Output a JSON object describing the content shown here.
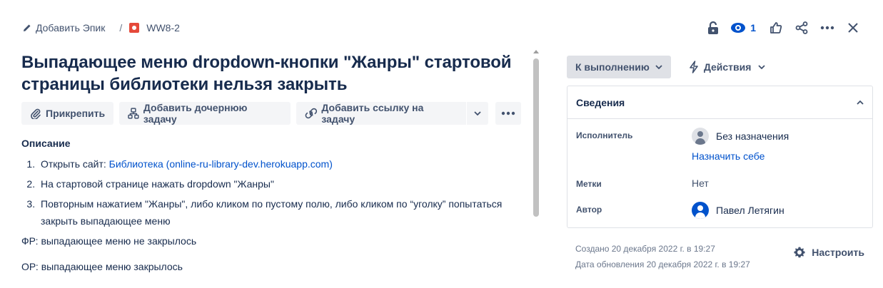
{
  "breadcrumb": {
    "epic_link": "Добавить Эпик",
    "separator": "/",
    "issue_key": "WW8-2"
  },
  "header_actions": {
    "watch_count": "1"
  },
  "issue": {
    "title": "Выпадающее меню dropdown-кнопки \"Жанры\" стартовой страницы библиотеки нельзя закрыть"
  },
  "toolbar": {
    "attach": "Прикрепить",
    "add_child": "Добавить дочернюю задачу",
    "add_link": "Добавить ссылку на задачу"
  },
  "description": {
    "label": "Описание",
    "step1_prefix": "Открыть сайт: ",
    "step1_link": "Библиотека (online-ru-library-dev.herokuapp.com)",
    "step2": "На стартовой странице нажать dropdown \"Жанры\"",
    "step3": "Повторным нажатием \"Жанры\", либо кликом по пустому полю, либо кликом по “уголку” попытаться закрыть выпадающее меню",
    "actual": "ФР: выпадающее меню не закрылось",
    "expected": "ОР: выпадающее меню закрылось"
  },
  "sidebar": {
    "status": "К выполнению",
    "actions": "Действия",
    "details_title": "Сведения",
    "assignee_label": "Исполнитель",
    "assignee_value": "Без назначения",
    "assign_self": "Назначить себе",
    "labels_label": "Метки",
    "labels_value": "Нет",
    "reporter_label": "Автор",
    "reporter_value": "Павел Летягин",
    "created": "Создано 20 декабря 2022 г. в 19:27",
    "updated": "Дата обновления 20 декабря 2022 г. в 19:27",
    "configure": "Настроить"
  },
  "colors": {
    "link": "#0052cc",
    "bug": "#e5493a",
    "text": "#172b4d",
    "muted": "#42526e"
  }
}
